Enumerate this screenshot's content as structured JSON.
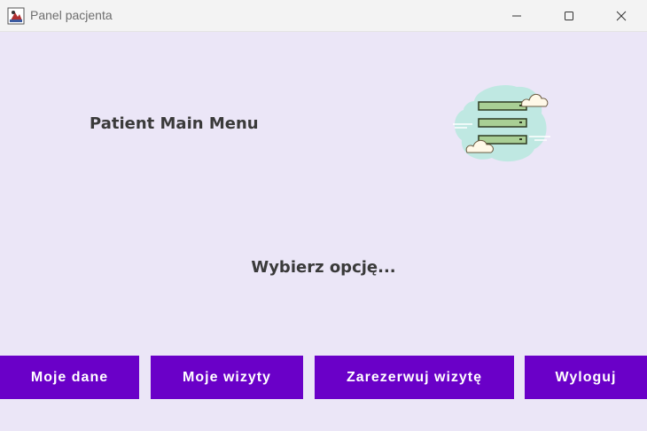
{
  "window": {
    "title": "Panel pacjenta",
    "controls": {
      "minimize_icon": "minimize-icon",
      "maximize_icon": "maximize-icon",
      "close_icon": "close-icon"
    }
  },
  "main": {
    "heading": "Patient Main Menu",
    "illustration_icon": "server-cloud-icon",
    "prompt": "Wybierz opcję..."
  },
  "buttons": {
    "my_data": "Moje dane",
    "my_visits": "Moje wizyty",
    "book_visit": "Zarezerwuj wizytę",
    "logout": "Wyloguj"
  },
  "colors": {
    "background": "#ebe6f7",
    "button": "#6a00c8",
    "button_text": "#ffffff",
    "text": "#3a3a3a"
  }
}
